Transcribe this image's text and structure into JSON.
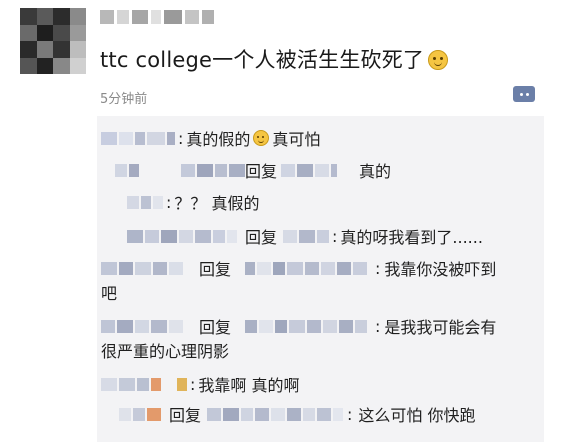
{
  "post": {
    "text": "ttc college一个人被活生生砍死了",
    "timestamp": "5分钟前"
  },
  "comments": [
    {
      "text": "真的假的",
      "suffix": "真可怕"
    },
    {
      "reply_label": "回复",
      "text": "真的"
    },
    {
      "text": "？？ 真假的"
    },
    {
      "reply_label": "回复",
      "text": "真的呀我看到了......"
    },
    {
      "reply_label": "回复",
      "text": "我靠你没被吓到",
      "text_line2": "吧"
    },
    {
      "reply_label": "回复",
      "text": "是我我可能会有",
      "text_line2": "很严重的心理阴影"
    },
    {
      "text": "我靠啊 真的啊"
    },
    {
      "reply_label": "回复",
      "text": "这么可怕 你快跑"
    }
  ]
}
